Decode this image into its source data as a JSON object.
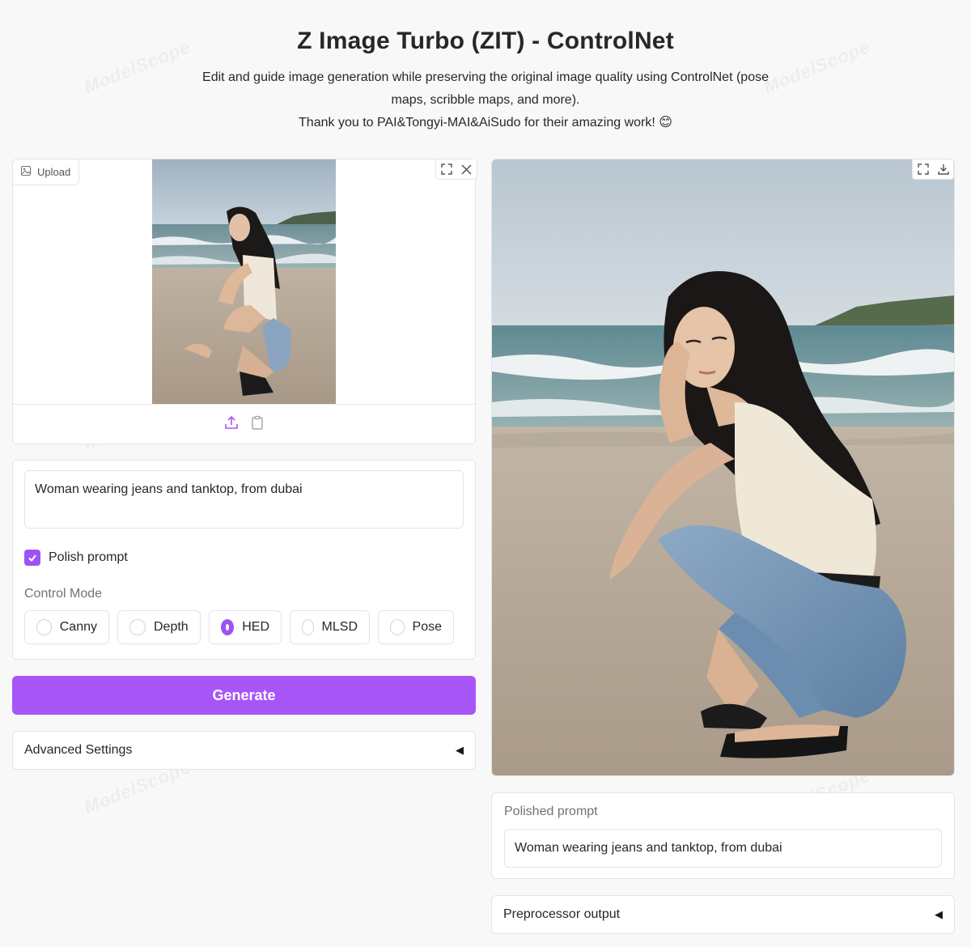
{
  "header": {
    "title": "Z Image Turbo (ZIT) - ControlNet",
    "description": "Edit and guide image generation while preserving the original image quality using ControlNet (pose maps, scribble maps, and more).",
    "thanks": "Thank you to PAI&Tongyi-MAI&AiSudo for their amazing work! 😊"
  },
  "watermark": "ModelScope",
  "input_image": {
    "upload_label": "Upload",
    "icons": [
      "image-icon",
      "fullscreen-icon",
      "close-icon",
      "upload-icon",
      "clipboard-icon"
    ]
  },
  "prompt": {
    "value": "Woman wearing jeans and tanktop, from dubai"
  },
  "polish": {
    "label": "Polish prompt",
    "checked": true
  },
  "control_mode": {
    "label": "Control Mode",
    "options": [
      "Canny",
      "Depth",
      "HED",
      "MLSD",
      "Pose"
    ],
    "selected": "HED"
  },
  "generate": {
    "label": "Generate"
  },
  "advanced": {
    "label": "Advanced Settings"
  },
  "output": {
    "icons": [
      "fullscreen-icon",
      "download-icon"
    ]
  },
  "polished_prompt": {
    "label": "Polished prompt",
    "value": "Woman wearing jeans and tanktop, from dubai"
  },
  "preprocessor": {
    "label": "Preprocessor output"
  },
  "colors": {
    "accent": "#a855f7",
    "background": "#f8f8f8",
    "border": "#e4e4e7"
  }
}
